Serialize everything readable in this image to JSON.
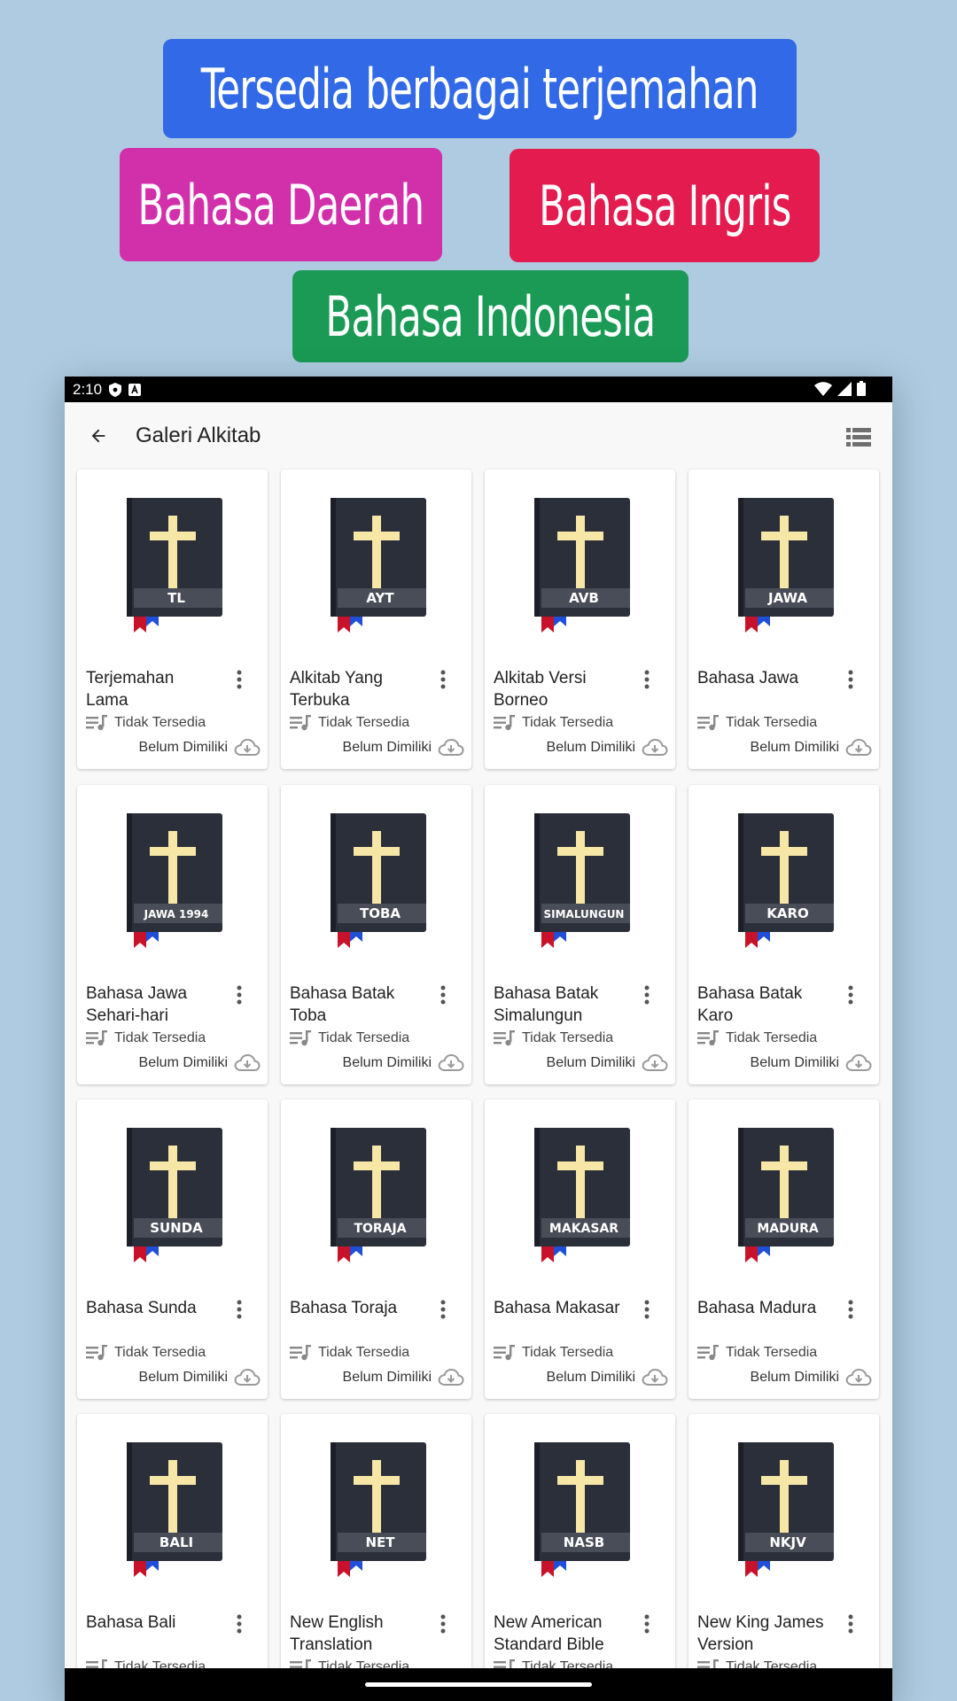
{
  "promo": {
    "headline": "Tersedia berbagai terjemahan",
    "daerah": "Bahasa Daerah",
    "ingris": "Bahasa Ingris",
    "indonesia": "Bahasa Indonesia",
    "colors": {
      "headline": "#3169e7",
      "daerah": "#d22fab",
      "ingris": "#e41b4f",
      "indonesia": "#1a9a55"
    }
  },
  "status_bar": {
    "time": "2:10"
  },
  "app_bar": {
    "title": "Galeri Alkitab"
  },
  "cards": [
    {
      "code": "TL",
      "name": "Terjemahan Lama",
      "availability": "Tidak Tersedia",
      "ownership": "Belum Dimiliki"
    },
    {
      "code": "AYT",
      "name": "Alkitab Yang Terbuka",
      "availability": "Tidak Tersedia",
      "ownership": "Belum Dimiliki"
    },
    {
      "code": "AVB",
      "name": "Alkitab Versi Borneo",
      "availability": "Tidak Tersedia",
      "ownership": "Belum Dimiliki"
    },
    {
      "code": "JAWA",
      "name": "Bahasa Jawa",
      "availability": "Tidak Tersedia",
      "ownership": "Belum Dimiliki"
    },
    {
      "code": "JAWA 1994",
      "name": "Bahasa Jawa Sehari-hari",
      "availability": "Tidak Tersedia",
      "ownership": "Belum Dimiliki"
    },
    {
      "code": "TOBA",
      "name": "Bahasa Batak Toba",
      "availability": "Tidak Tersedia",
      "ownership": "Belum Dimiliki"
    },
    {
      "code": "SIMALUNGUN",
      "name": "Bahasa Batak Simalungun",
      "availability": "Tidak Tersedia",
      "ownership": "Belum Dimiliki"
    },
    {
      "code": "KARO",
      "name": "Bahasa Batak Karo",
      "availability": "Tidak Tersedia",
      "ownership": "Belum Dimiliki"
    },
    {
      "code": "SUNDA",
      "name": "Bahasa Sunda",
      "availability": "Tidak Tersedia",
      "ownership": "Belum Dimiliki"
    },
    {
      "code": "TORAJA",
      "name": "Bahasa Toraja",
      "availability": "Tidak Tersedia",
      "ownership": "Belum Dimiliki"
    },
    {
      "code": "MAKASAR",
      "name": "Bahasa Makasar",
      "availability": "Tidak Tersedia",
      "ownership": "Belum Dimiliki"
    },
    {
      "code": "MADURA",
      "name": "Bahasa Madura",
      "availability": "Tidak Tersedia",
      "ownership": "Belum Dimiliki"
    },
    {
      "code": "BALI",
      "name": "Bahasa Bali",
      "availability": "Tidak Tersedia",
      "ownership": ""
    },
    {
      "code": "NET",
      "name": "New English Translation",
      "availability": "Tidak Tersedia",
      "ownership": ""
    },
    {
      "code": "NASB",
      "name": "New American Standard Bible",
      "availability": "Tidak Tersedia",
      "ownership": ""
    },
    {
      "code": "NKJV",
      "name": "New King James Version",
      "availability": "Tidak Tersedia",
      "ownership": ""
    }
  ]
}
